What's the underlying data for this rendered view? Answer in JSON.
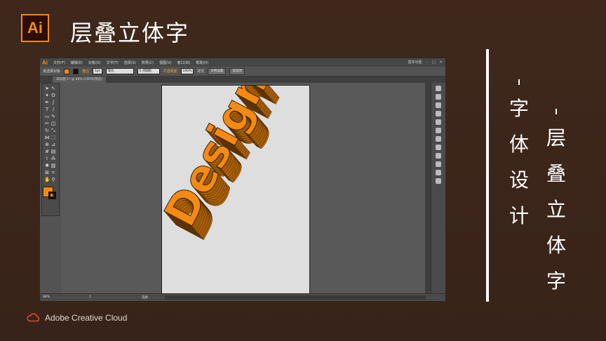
{
  "header": {
    "logo": "Ai",
    "title": "层叠立体字"
  },
  "footer": {
    "brand": "Adobe Creative Cloud"
  },
  "right_text": {
    "col1": [
      "字",
      "体",
      "设",
      "计"
    ],
    "col2": [
      "层",
      "叠",
      "立",
      "体",
      "字"
    ]
  },
  "colors": {
    "accent": "#f58a13",
    "background": "#3b2518"
  },
  "app": {
    "logo": "Ai",
    "menus": [
      "文件(F)",
      "编辑(E)",
      "对象(O)",
      "文字(T)",
      "选择(S)",
      "效果(C)",
      "视图(V)",
      "窗口(W)",
      "帮助(H)"
    ],
    "workspace": "基本功能",
    "control": {
      "selection": "未选择对象",
      "stroke_label": "描边",
      "stroke_value": "1pt",
      "profile": "等比",
      "brush": "5 点圆形",
      "opacity_label": "不透明度",
      "opacity_value": "100%",
      "style_label": "样式",
      "doc_setup": "文档设置",
      "preferences": "首选项"
    },
    "tab": "未标题-1* @ 88% (CMYK/预览)",
    "status": {
      "zoom": "88%",
      "page": "1",
      "tool": "选择"
    }
  },
  "artwork": {
    "text": "Design",
    "color": "#f58a13"
  }
}
